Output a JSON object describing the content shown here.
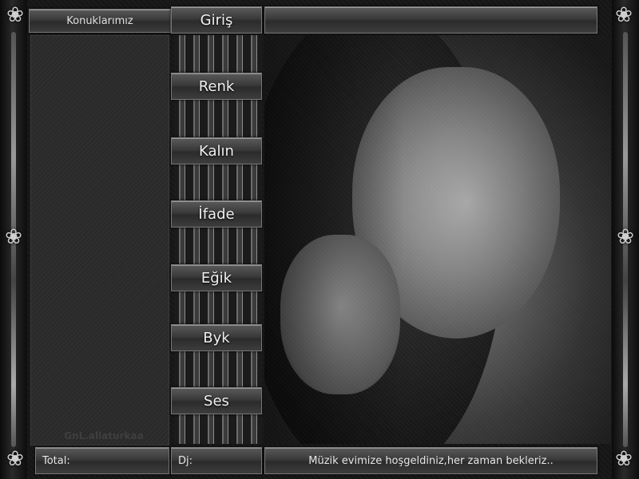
{
  "sidebar": {
    "header_label": "Konuklarımız",
    "credit": "GnL.allaturkaa"
  },
  "controls": {
    "buttons": [
      {
        "label": "Giriş"
      },
      {
        "label": "Renk"
      },
      {
        "label": "Kalın"
      },
      {
        "label": "İfade"
      },
      {
        "label": "Eğik"
      },
      {
        "label": "Byk"
      },
      {
        "label": "Ses"
      }
    ]
  },
  "status": {
    "total_label": "Total:",
    "dj_label": "Dj:",
    "welcome": "Müzik evimize hoşgeldiniz,her zaman bekleriz.."
  },
  "theme": {
    "text": "#f0f0f0",
    "bar": "#3a3a3a",
    "frame": "#161616"
  },
  "icons": {
    "ornament": "lily-flower-icon"
  }
}
